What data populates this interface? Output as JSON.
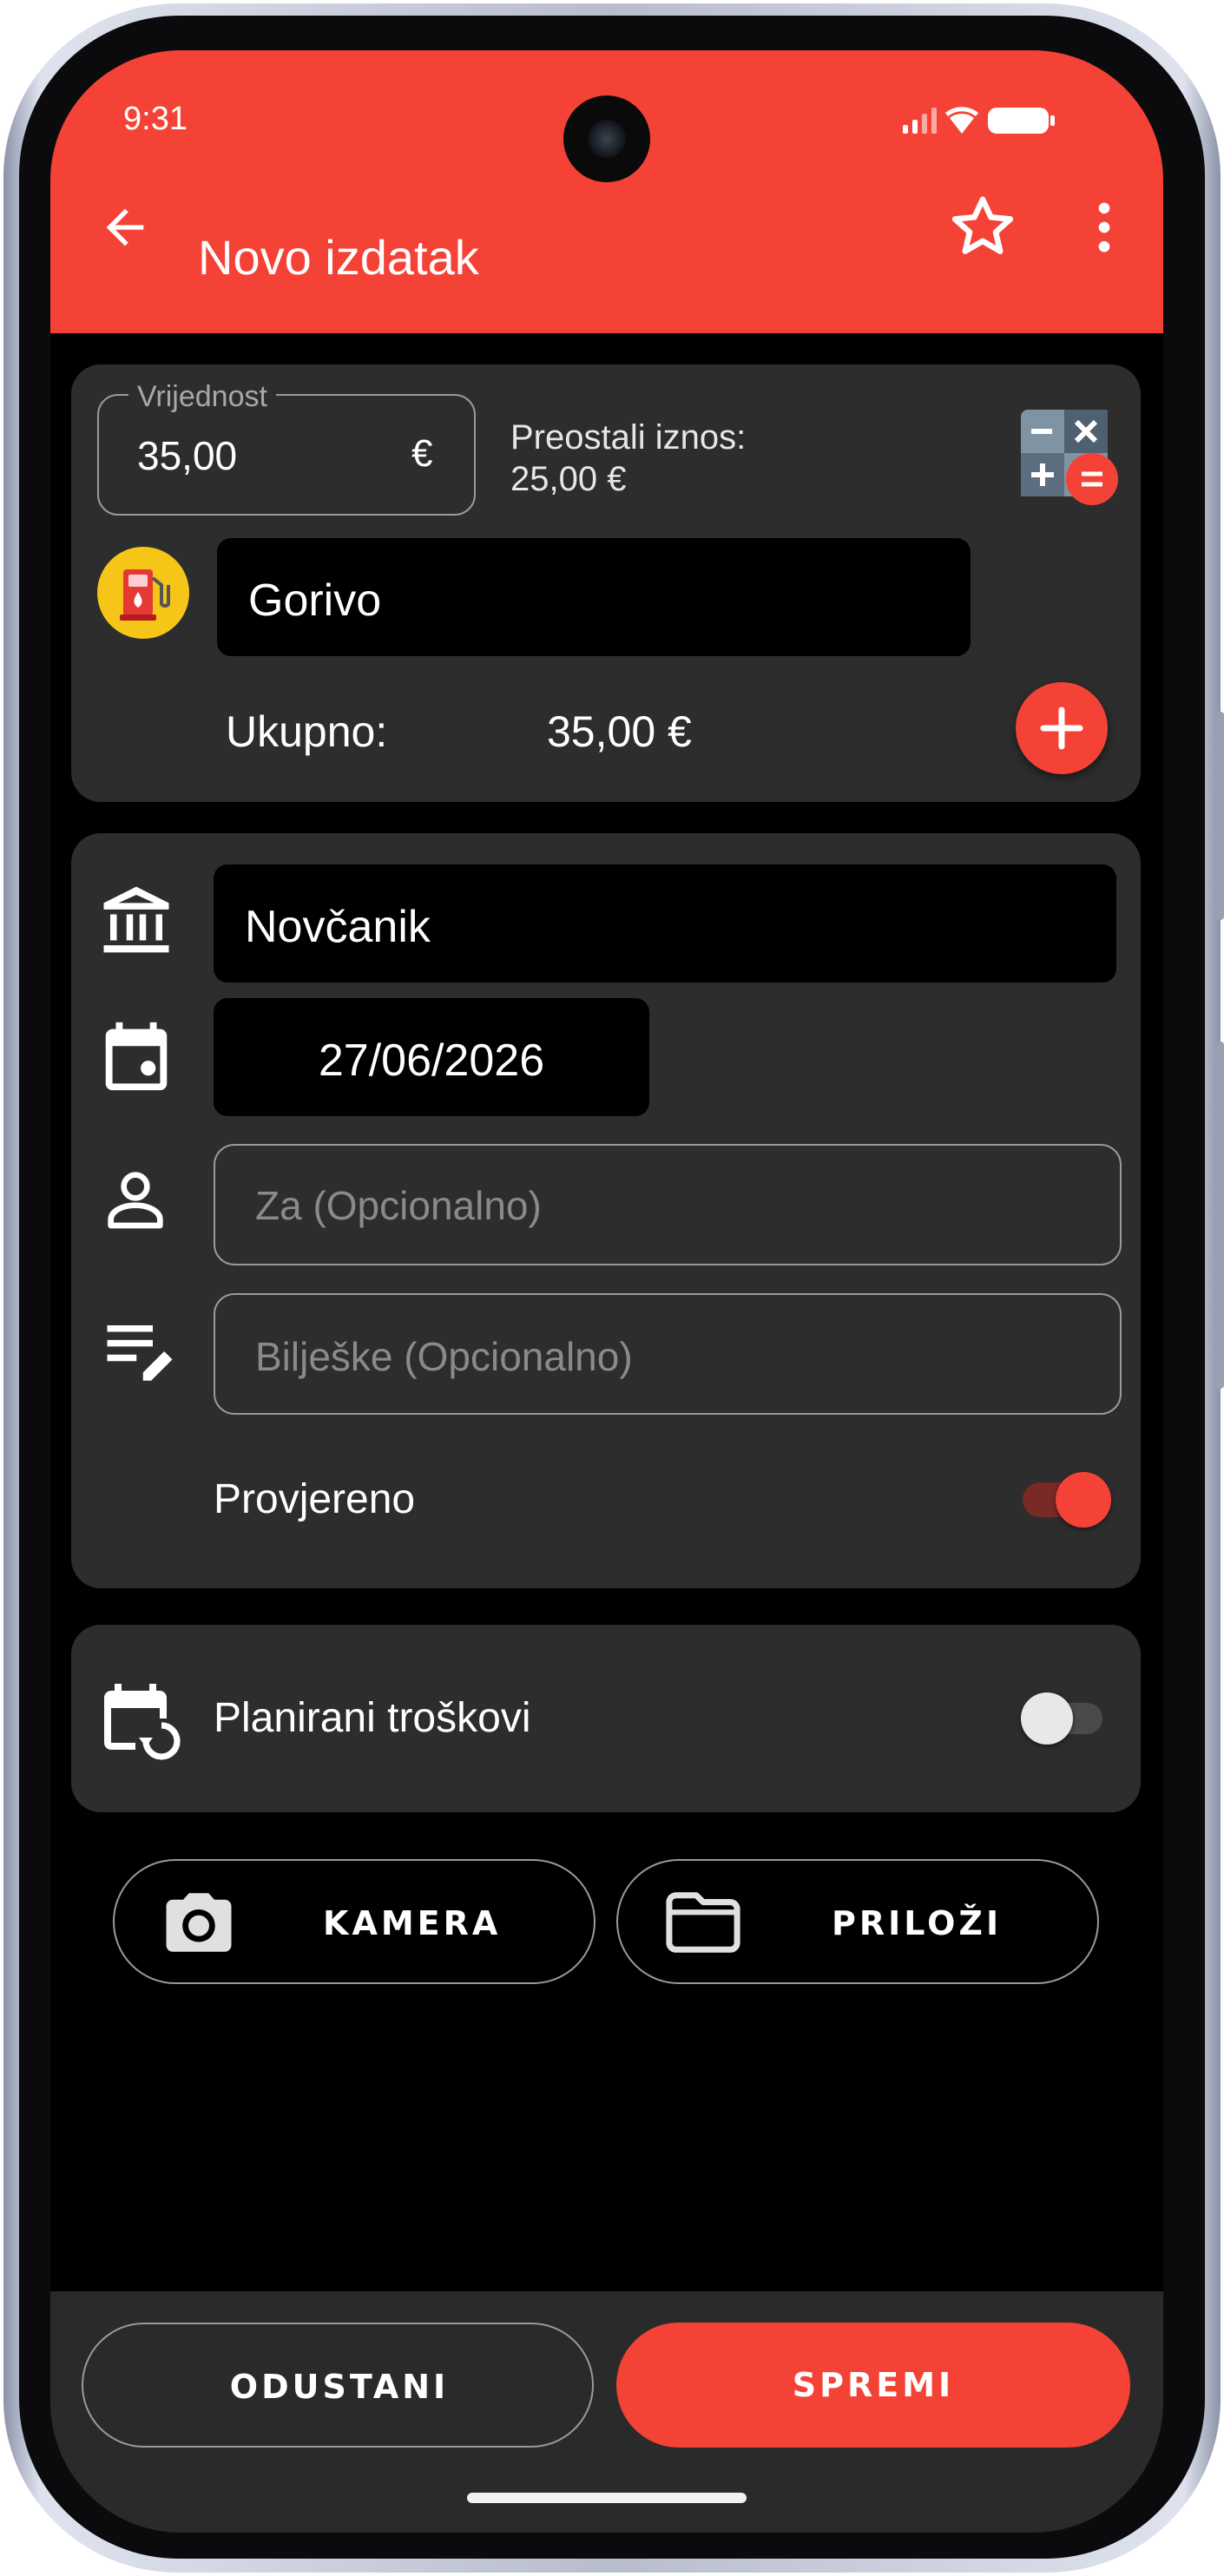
{
  "status_bar": {
    "time": "9:31"
  },
  "app_bar": {
    "title": "Novo izdatak",
    "icons": [
      "back-arrow-icon",
      "star-icon",
      "more-vert-icon"
    ]
  },
  "amount": {
    "label": "Vrijednost",
    "value": "35,00",
    "currency": "€",
    "remaining_label": "Preostali iznos:",
    "remaining_value": "25,00 €"
  },
  "category": {
    "name": "Gorivo",
    "icon": "fuel-pump-icon"
  },
  "total": {
    "label": "Ukupno:",
    "value": "35,00 €"
  },
  "details": {
    "account": "Novčanik",
    "date": "27/06/2026",
    "payee_placeholder": "Za (Opcionalno)",
    "notes_placeholder": "Bilješke (Opcionalno)",
    "verified_label": "Provjereno",
    "verified": true
  },
  "planned": {
    "label": "Planirani troškovi",
    "enabled": false
  },
  "attachments": {
    "camera_label": "KAMERA",
    "attach_label": "PRILOŽI"
  },
  "footer": {
    "cancel_label": "ODUSTANI",
    "save_label": "SPREMI"
  },
  "colors": {
    "accent": "#f44336",
    "card": "#2d2d2d",
    "fuel_icon_bg": "#f5c518"
  }
}
